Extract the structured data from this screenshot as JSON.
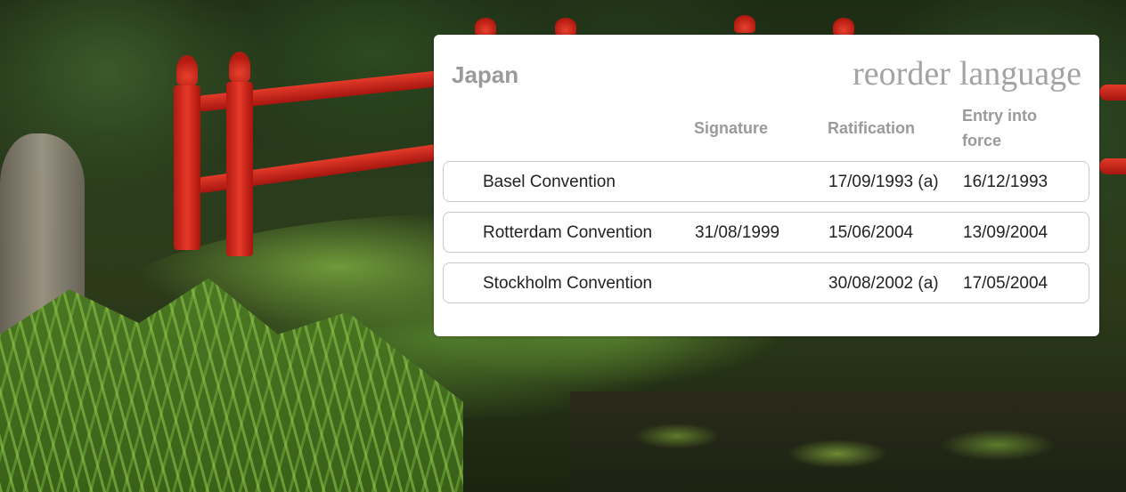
{
  "country": "Japan",
  "language_links": [
    "reorder",
    "language"
  ],
  "columns": {
    "signature": "Signature",
    "ratification": "Ratification",
    "entry_into_force_line1": "Entry into",
    "entry_into_force_line2": "force"
  },
  "rows": [
    {
      "name": "Basel Convention",
      "signature": "",
      "ratification": "17/09/1993 (a)",
      "entry_into_force": "16/12/1993"
    },
    {
      "name": "Rotterdam Convention",
      "signature": "31/08/1999",
      "ratification": "15/06/2004",
      "entry_into_force": "13/09/2004"
    },
    {
      "name": "Stockholm Convention",
      "signature": "",
      "ratification": "30/08/2002 (a)",
      "entry_into_force": "17/05/2004"
    }
  ],
  "colors": {
    "panel_background": "#ffffff",
    "muted_text": "#9a9a9a",
    "body_text": "#222222",
    "row_border": "#c8c8c8",
    "bridge_red": "#e23a2a"
  }
}
